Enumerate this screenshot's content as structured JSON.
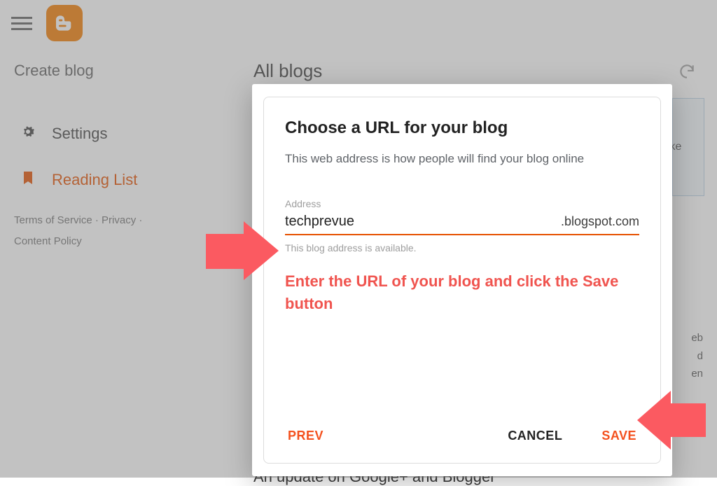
{
  "topbar": {},
  "sidebar": {
    "create_blog": "Create blog",
    "items": [
      {
        "label": "Settings"
      },
      {
        "label": "Reading List"
      }
    ],
    "footer": {
      "terms": "Terms of Service",
      "privacy": "Privacy",
      "content_policy": "Content Policy",
      "dot": " · "
    }
  },
  "header": {
    "title": "All blogs"
  },
  "modal": {
    "title": "Choose a URL for your blog",
    "subtitle": "This web address is how people will find your blog online",
    "field_label": "Address",
    "address_value": "techprevue",
    "suffix": ".blogspot.com",
    "availability": "This blog address is available.",
    "annotation": "Enter the URL of your blog and click the Save button",
    "buttons": {
      "prev": "PREV",
      "cancel": "CANCEL",
      "save": "SAVE"
    }
  },
  "background": {
    "strip1": "ike",
    "strip2_lines": "eb\nd\nen",
    "truncated_heading": "An update on Google+ and Blogger"
  }
}
